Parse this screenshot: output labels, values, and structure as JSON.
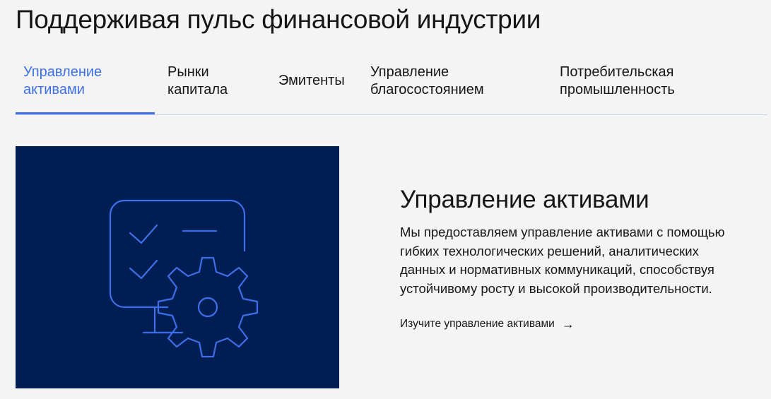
{
  "header": {
    "title": "Поддерживая пульс финансовой индустрии"
  },
  "tabs": [
    {
      "line1": "Управление",
      "line2": "активами",
      "active": true
    },
    {
      "line1": "Рынки",
      "line2": "капитала",
      "active": false
    },
    {
      "line1": "Эмитенты",
      "line2": "",
      "active": false
    },
    {
      "line1": "Управление",
      "line2": "благосостоянием",
      "active": false
    },
    {
      "line1": "Потребительская",
      "line2": "промышленность",
      "active": false
    }
  ],
  "hero": {
    "icon": "monitor-checklist-gear-icon",
    "background": "#001d54",
    "icon_color": "#3d70e8"
  },
  "content": {
    "title": "Управление активами",
    "description": "Мы предоставляем управление активами с помощью гибких технологических решений, аналитических данных и нормативных коммуникаций, способствуя устойчивому росту и высокой производительности.",
    "link_label": "Изучите управление активами",
    "link_icon": "arrow-right-icon"
  },
  "colors": {
    "accent": "#3d70e8",
    "text": "#161616",
    "background": "#f4f4f4",
    "divider": "#c6d4f0"
  }
}
